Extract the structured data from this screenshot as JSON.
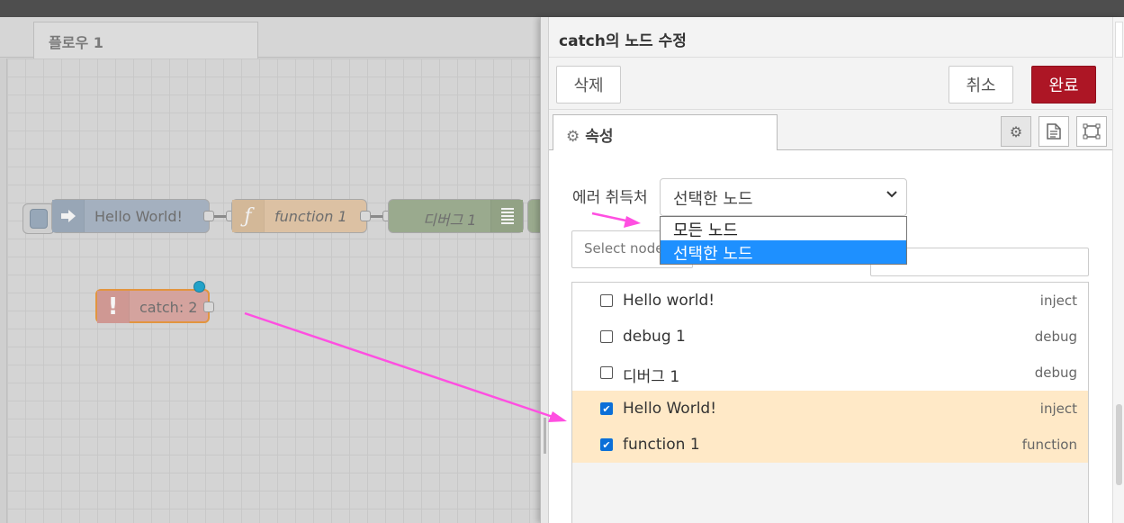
{
  "workspace": {
    "flow_tab": "플로우 1",
    "nodes": {
      "inject": "Hello World!",
      "function": "function 1",
      "debug": "디버그 1",
      "catch": "catch: 2"
    }
  },
  "tray": {
    "title": "catch의 노드 수정",
    "delete_label": "삭제",
    "cancel_label": "취소",
    "done_label": "완료",
    "tab_properties": "속성",
    "scope_label": "에러 취득처",
    "scope_value": "선택한 노드",
    "scope_options": [
      "모든 노드",
      "선택한 노드"
    ],
    "select_nodes_label": "Select node",
    "node_rows": [
      {
        "name": "Hello world!",
        "type": "inject",
        "checked": false
      },
      {
        "name": "debug 1",
        "type": "debug",
        "checked": false
      },
      {
        "name": "디버그 1",
        "type": "debug",
        "checked": false
      },
      {
        "name": "Hello World!",
        "type": "inject",
        "checked": true
      },
      {
        "name": "function 1",
        "type": "function",
        "checked": true
      }
    ]
  },
  "colors": {
    "done_button": "#ad1625",
    "selected_option": "#1e90ff",
    "checked_row": "#ffe9c7",
    "annotation_arrow": "#ff4fe1"
  },
  "icons": [
    "arrow-right-icon",
    "function-icon",
    "list-icon",
    "exclamation-icon",
    "gear-icon",
    "document-icon",
    "frame-icon",
    "chevron-down-icon",
    "check-icon"
  ]
}
